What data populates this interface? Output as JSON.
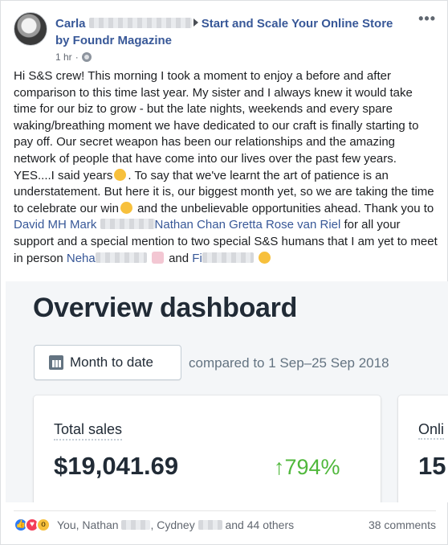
{
  "post": {
    "author_first": "Carla",
    "group": "Start and Scale Your Online Store",
    "via": "by Foundr Magazine",
    "time": "1 hr",
    "more": "•••",
    "body": {
      "p1": "Hi S&S crew! This morning I took a moment to enjoy a before and after comparison to this time last year. My sister and I always knew it would take time for our biz to grow - but the late nights, weekends and every spare waking/breathing moment we have dedicated to our craft is finally starting to pay off. Our secret weapon has been our relationships and the amazing network of people that have come into our lives over the past few years. YES....I said years",
      "p2": ". To say that we've learnt the art of patience is an understatement. But here it is, our biggest month yet, so we are taking the time to celebrate our win",
      "p3": " and the unbelievable opportunities ahead. Thank you to ",
      "mention1": "David MH Mark",
      "mention2": "Nathan Chan",
      "mention3": "Gretta Rose van Riel",
      "p4": " for all your support and a special mention to two special S&S humans that I am yet to meet in person ",
      "mention4": "Neha",
      "and": " and ",
      "mention5": "Fi"
    }
  },
  "screenshot": {
    "title": "Overview dashboard",
    "date_button": "Month to date",
    "compare": "compared to 1 Sep–25 Sep 2018",
    "card1": {
      "label": "Total sales",
      "value": "$19,041.69",
      "change": "↑794%"
    },
    "card2": {
      "label": "Onli",
      "value": "15"
    }
  },
  "footer": {
    "likers_a": "You, Nathan",
    "likers_b": ", Cydney",
    "likers_c": " and 44 others",
    "comments": "38 comments"
  }
}
